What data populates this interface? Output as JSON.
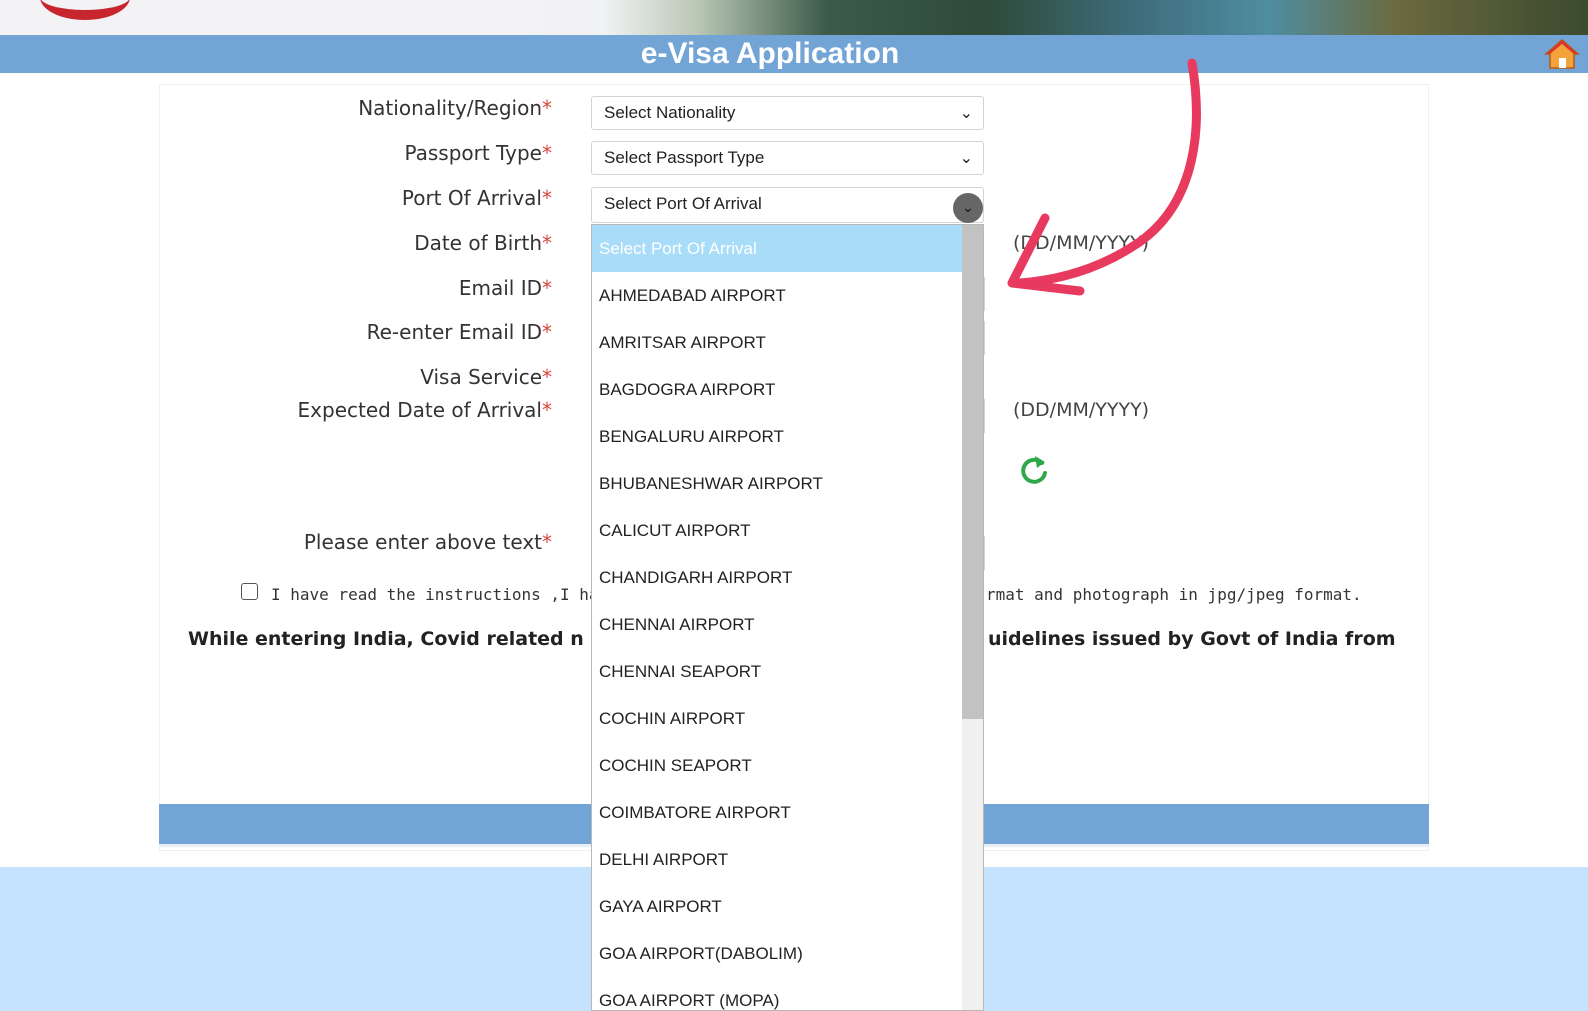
{
  "header": {
    "title": "e-Visa Application",
    "colors": {
      "titlebar": "#73a4d6",
      "required": "#d9463c",
      "selected_option": "#a8dcf8",
      "annotation_arrow": "#e83a5f"
    }
  },
  "form": {
    "fields": [
      {
        "label": "Nationality/Region",
        "required": "*",
        "value": "Select Nationality"
      },
      {
        "label": "Passport Type",
        "required": "*",
        "value": "Select Passport Type"
      },
      {
        "label": "Port Of Arrival",
        "required": "*",
        "value": "Select Port Of Arrival"
      },
      {
        "label": "Date of Birth",
        "required": "*",
        "hint": "(DD/MM/YYYY)"
      },
      {
        "label": "Email ID",
        "required": "*"
      },
      {
        "label": "Re-enter Email ID",
        "required": "*"
      },
      {
        "label": "Visa Service",
        "required": "*"
      },
      {
        "label": "Expected Date of Arrival",
        "required": "*",
        "hint": "(DD/MM/YYYY)"
      },
      {
        "label": "Please enter above text",
        "required": "*"
      }
    ],
    "agreement": {
      "text_left": "I have read the instructions ,I have",
      "text_right": "rmat and photograph in jpg/jpeg format."
    },
    "covid": {
      "text_left": "While entering India, Covid related n",
      "text_right": "uidelines issued by Govt of India from"
    }
  },
  "dropdown": {
    "options": [
      "Select Port Of Arrival",
      "AHMEDABAD AIRPORT",
      "AMRITSAR AIRPORT",
      "BAGDOGRA AIRPORT",
      "BENGALURU AIRPORT",
      "BHUBANESHWAR AIRPORT",
      "CALICUT AIRPORT",
      "CHANDIGARH AIRPORT",
      "CHENNAI AIRPORT",
      "CHENNAI SEAPORT",
      "COCHIN AIRPORT",
      "COCHIN SEAPORT",
      "COIMBATORE AIRPORT",
      "DELHI AIRPORT",
      "GAYA AIRPORT",
      "GOA AIRPORT(DABOLIM)",
      "GOA AIRPORT (MOPA)"
    ]
  },
  "icons": {
    "home": "home-icon",
    "refresh": "refresh-icon",
    "dropdown": "chevron-down-icon"
  }
}
